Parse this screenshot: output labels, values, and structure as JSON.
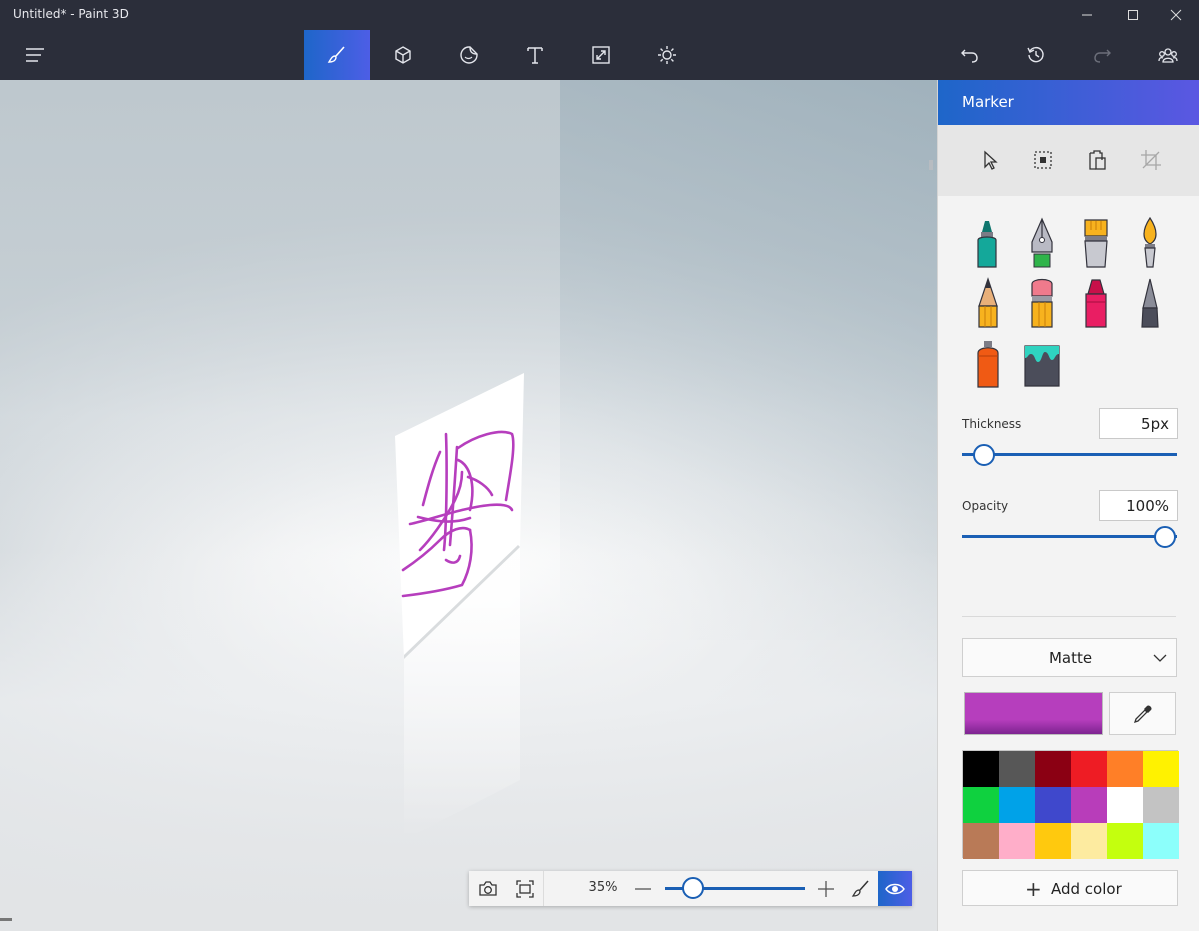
{
  "window": {
    "title": "Untitled* - Paint 3D",
    "controls": [
      "minimize-icon",
      "maximize-icon",
      "close-icon"
    ]
  },
  "toolbar": {
    "left": [
      {
        "name": "menu",
        "icon": "hamburger-menu-icon"
      }
    ],
    "center": [
      {
        "name": "brushes",
        "icon": "brush-icon",
        "active": true
      },
      {
        "name": "3d-shapes",
        "icon": "cube-icon",
        "active": false
      },
      {
        "name": "stickers",
        "icon": "sticker-icon",
        "active": false
      },
      {
        "name": "text",
        "icon": "text-icon",
        "active": false
      },
      {
        "name": "canvas",
        "icon": "canvas-resize-icon",
        "active": false
      },
      {
        "name": "effects",
        "icon": "sun-icon",
        "active": false
      }
    ],
    "right": [
      {
        "name": "undo",
        "icon": "undo-icon",
        "enabled": true
      },
      {
        "name": "history",
        "icon": "history-icon",
        "enabled": true
      },
      {
        "name": "redo",
        "icon": "redo-icon",
        "enabled": false
      },
      {
        "name": "remix",
        "icon": "community-icon",
        "enabled": true
      }
    ]
  },
  "viewbar": {
    "zoom_label": "35%",
    "zoom_level": 0.2,
    "buttons": [
      "camera-icon",
      "fit-screen-icon",
      "zoom-out-icon",
      "zoom-in-icon",
      "brush-icon",
      "eye-icon"
    ]
  },
  "panel": {
    "title": "Marker",
    "select_tools": [
      "pointer-icon",
      "select-icon",
      "paste-icon",
      "crop-icon"
    ],
    "brushes": [
      {
        "name": "marker",
        "icon": "marker-icon",
        "selected": true
      },
      {
        "name": "calligraphy-pen",
        "icon": "calligraphy-pen-icon"
      },
      {
        "name": "oil-brush",
        "icon": "oil-brush-icon"
      },
      {
        "name": "watercolor",
        "icon": "watercolor-icon"
      },
      {
        "name": "pencil",
        "icon": "pencil-icon"
      },
      {
        "name": "eraser",
        "icon": "eraser-icon"
      },
      {
        "name": "crayon",
        "icon": "crayon-icon"
      },
      {
        "name": "pixel-pen",
        "icon": "pixel-pen-icon"
      },
      {
        "name": "spray-can",
        "icon": "spray-can-icon"
      },
      {
        "name": "fill",
        "icon": "fill-bucket-icon"
      }
    ],
    "thickness": {
      "label": "Thickness",
      "value": "5px",
      "level": 0.1
    },
    "opacity": {
      "label": "Opacity",
      "value": "100%",
      "level": 1.0
    },
    "finish": {
      "selected": "Matte"
    },
    "current_color": "#b63ebd",
    "palette": [
      "#000000",
      "#575757",
      "#8b0013",
      "#ee1c24",
      "#ff7f27",
      "#fff200",
      "#0fd13f",
      "#00a2e8",
      "#3f48cc",
      "#b83dba",
      "#ffffff",
      "#c3c3c3",
      "#b97a57",
      "#ffaec9",
      "#ffc90e",
      "#fdeba0",
      "#c4ff0e",
      "#8cfffb"
    ],
    "add_color_label": "Add color"
  },
  "colors": {
    "accent": "#1e66c9",
    "accent_end": "#5b57e2",
    "titlebar": "#2b2e3a",
    "stroke": "#b63ebd"
  }
}
